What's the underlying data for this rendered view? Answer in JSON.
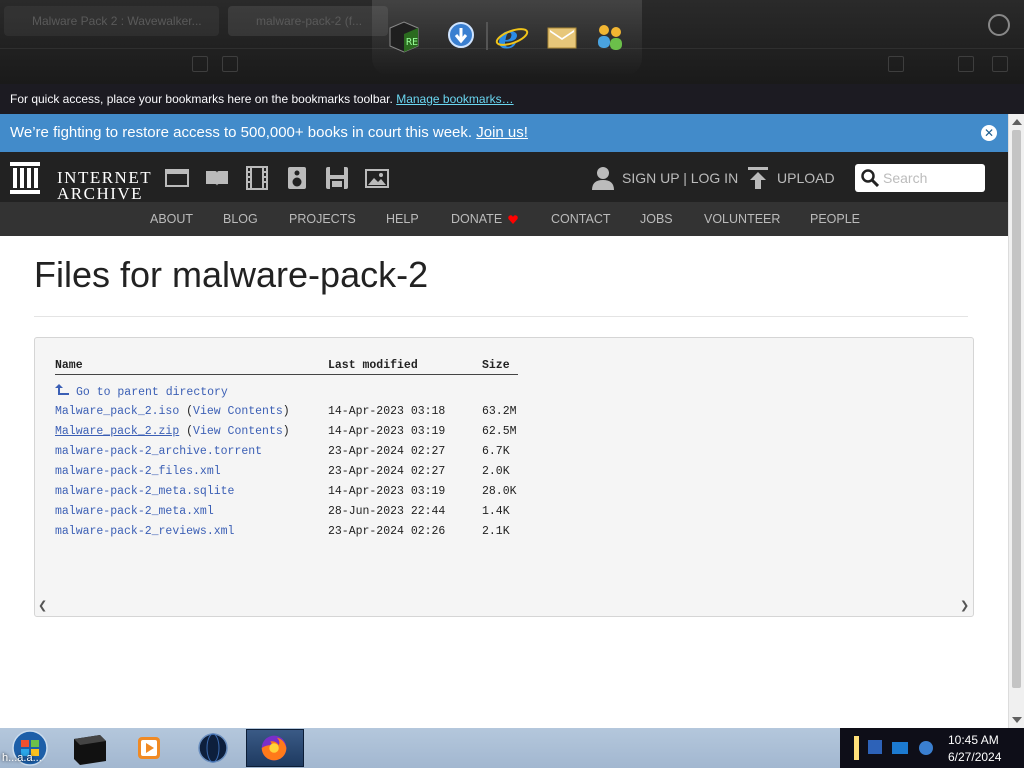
{
  "browser": {
    "ghost_tabs": [
      "Malware Pack 2 : Wavewalker...",
      "malware-pack-2 (f..."
    ],
    "bookmarks_bar": {
      "message": "For quick access, place your bookmarks here on the bookmarks toolbar.",
      "link": "Manage bookmarks…"
    }
  },
  "announcement": {
    "text": "We’re fighting to restore access to 500,000+ books in court this week.",
    "link": "Join us!",
    "close": "✕"
  },
  "header": {
    "logo_line1": "INTERNET",
    "logo_line2": "ARCHIVE",
    "account": "SIGN UP | LOG IN",
    "upload": "UPLOAD",
    "search_placeholder": "Search"
  },
  "nav": [
    "ABOUT",
    "BLOG",
    "PROJECTS",
    "HELP",
    "DONATE",
    "CONTACT",
    "JOBS",
    "VOLUNTEER",
    "PEOPLE"
  ],
  "page": {
    "title": "Files for malware-pack-2"
  },
  "files": {
    "columns": [
      "Name",
      "Last modified",
      "Size"
    ],
    "parent_link": "Go to parent directory",
    "view_contents": "View Contents",
    "rows": [
      {
        "name": "Malware_pack_2.iso",
        "view": true,
        "modified": "14-Apr-2023 03:18",
        "size": "63.2M"
      },
      {
        "name": "Malware_pack_2.zip",
        "view": true,
        "modified": "14-Apr-2023 03:19",
        "size": "62.5M"
      },
      {
        "name": "malware-pack-2_archive.torrent",
        "view": false,
        "modified": "23-Apr-2024 02:27",
        "size": "6.7K"
      },
      {
        "name": "malware-pack-2_files.xml",
        "view": false,
        "modified": "23-Apr-2024 02:27",
        "size": "2.0K"
      },
      {
        "name": "malware-pack-2_meta.sqlite",
        "view": false,
        "modified": "14-Apr-2023 03:19",
        "size": "28.0K"
      },
      {
        "name": "malware-pack-2_meta.xml",
        "view": false,
        "modified": "28-Jun-2023 22:44",
        "size": "1.4K"
      },
      {
        "name": "malware-pack-2_reviews.xml",
        "view": false,
        "modified": "23-Apr-2024 02:26",
        "size": "2.1K"
      }
    ]
  },
  "taskbar": {
    "start_label": "h...a.a...",
    "time": "10:45 AM",
    "date": "6/27/2024"
  },
  "colors": {
    "announcement_bg": "#428bca",
    "header_bg": "#222222",
    "nav_bg": "#333333",
    "link": "#3b5fb5",
    "donate_heart": "#ff0100"
  },
  "icons": [
    "web-icon",
    "texts-icon",
    "video-icon",
    "audio-icon",
    "software-icon",
    "images-icon",
    "user-icon",
    "upload-icon",
    "search-icon",
    "heart-icon",
    "parent-arrow-icon"
  ]
}
